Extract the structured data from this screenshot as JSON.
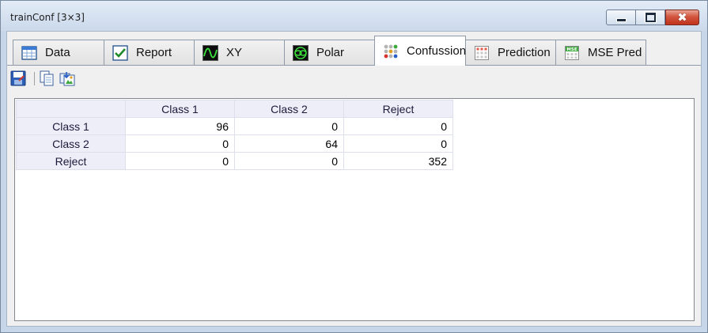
{
  "window": {
    "title": "trainConf [3×3]",
    "close_glyph": "✖"
  },
  "tabs": [
    {
      "label": "Data",
      "icon": "table-icon"
    },
    {
      "label": "Report",
      "icon": "checkmark-icon"
    },
    {
      "label": "XY",
      "icon": "xy-plot-icon"
    },
    {
      "label": "Polar",
      "icon": "polar-plot-icon"
    },
    {
      "label": "Confussion",
      "icon": "dots-matrix-icon",
      "active": true
    },
    {
      "label": "Prediction",
      "icon": "grid-icon"
    },
    {
      "label": "MSE Pred",
      "icon": "mse-icon",
      "icon_text": "MSE"
    }
  ],
  "toolbar": {
    "icons": [
      "save-icon",
      "copy-icon",
      "export-image-icon"
    ]
  },
  "matrix": {
    "columns": [
      "Class 1",
      "Class 2",
      "Reject"
    ],
    "rows": [
      {
        "label": "Class 1",
        "values": [
          "96",
          "0",
          "0"
        ]
      },
      {
        "label": "Class 2",
        "values": [
          "0",
          "64",
          "0"
        ]
      },
      {
        "label": "Reject",
        "values": [
          "0",
          "0",
          "352"
        ]
      }
    ]
  },
  "colors": {
    "header_bg": "#eeeef9",
    "window_frame": "#c7d6e8",
    "close_red": "#c0321c"
  }
}
